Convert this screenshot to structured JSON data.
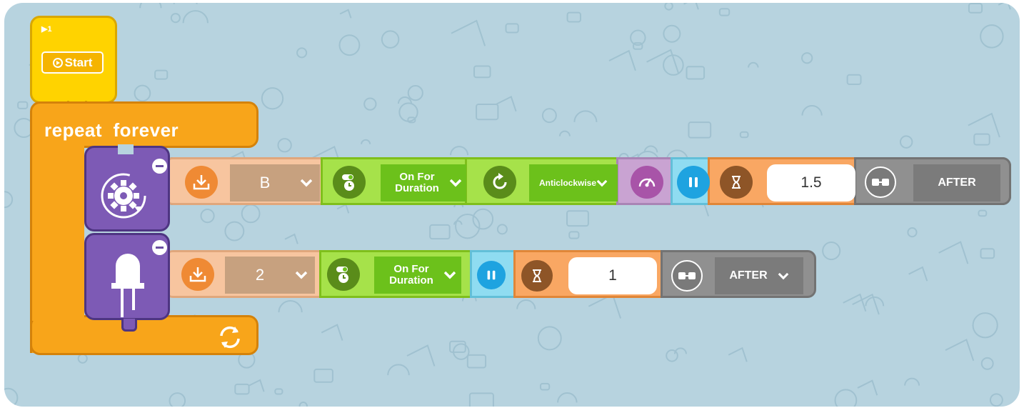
{
  "start": {
    "step_label": "▶1",
    "start_label": "Start"
  },
  "repeat": {
    "label": "repeat  forever"
  },
  "row1": {
    "port_value": "B",
    "mode_label": "On For Duration",
    "direction_label": "Anticlockwise",
    "duration_value": "1.5",
    "after_label": "AFTER"
  },
  "row2": {
    "port_value": "2",
    "mode_label": "On For Duration",
    "duration_value": "1",
    "after_label": "AFTER"
  },
  "colors": {
    "start_yellow": "#ffd300",
    "repeat_orange": "#f8a51a",
    "actuator_purple": "#7d5ab5",
    "port_peach": "#f7c59f",
    "mode_green": "#a6e24a",
    "speed_mauve": "#c9a3d2",
    "pause_cyan": "#8fdcf1",
    "timer_orange": "#f9a763",
    "after_gray": "#909090",
    "background": "#b7d3df"
  },
  "icons": [
    "download-icon",
    "chevron-down-icon",
    "timer-toggle-icon",
    "rotate-icon",
    "speedometer-icon",
    "pause-icon",
    "hourglass-icon",
    "link-icon",
    "gear-motor-icon",
    "led-icon",
    "repeat-cycle-icon",
    "play-circle-icon"
  ]
}
